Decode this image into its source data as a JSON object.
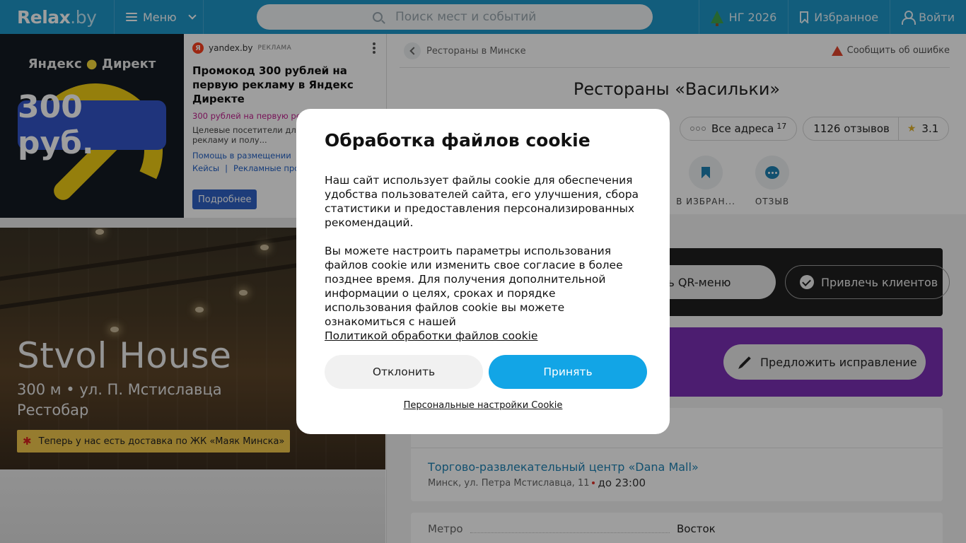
{
  "header": {
    "logo": "Relax",
    "logo_suffix": ".by",
    "menu_label": "Меню",
    "search_placeholder": "Поиск мест и событий",
    "ng_label": "НГ 2026",
    "favorites_label": "Избранное",
    "login_label": "Войти",
    "bg_color": "#1e96c8"
  },
  "ad": {
    "image_brand_left": "Яндекс",
    "image_brand_right": "Директ",
    "image_price": "300 руб.",
    "source": "yandex.by",
    "source_tag": "РЕКЛАМА",
    "title": "Промокод 300 рублей на первую рекламу в Яндекс Директе",
    "subtitle": "300 рублей на первую рекламу в подарок!",
    "text": "Целевые посетители для ли... Запустите рекламу и полу...",
    "links": [
      "Помощь в размещении",
      "|",
      "Кейсы",
      "|",
      "Рекламные про..."
    ],
    "button_label": "Подробнее"
  },
  "hero": {
    "title": "Stvol House",
    "address": "300 м • ул. П. Мстиславца",
    "type": "Рестобар",
    "banner": "Теперь у нас есть доставка по ЖК «Маяк Минска»"
  },
  "page": {
    "breadcrumb": "Рестораны в Минске",
    "report_label": "Сообщить об ошибке",
    "title": "Рестораны «Васильки»",
    "chips": {
      "addresses_label": "Все адреса",
      "addresses_count": "17",
      "reviews_label": "1126 отзывов",
      "rating": "3.1"
    },
    "actions": [
      {
        "label": "В ИЗБРАН..."
      },
      {
        "label": "ОТЗЫВ"
      }
    ],
    "qr_label": "ть QR-меню",
    "attract_label": "Привлечь клиентов",
    "suggest_label": "Предложить исправление",
    "mall_name": "Торгово-развлекательный центр «Dana Mall»",
    "mall_address": "Минск, ул. Петра Мстиславца, 11",
    "mall_hours": "до 23:00",
    "metro_key": "Метро",
    "metro_value": "Восток"
  },
  "cookie": {
    "title": "Обработка файлов cookie",
    "p1": "Наш сайт использует файлы cookie для обеспечения удобства пользователей сайта, его улучшения, сбора статистики и предоставления персонализированных рекомендаций.",
    "p2": "Вы можете настроить параметры использования файлов cookie или изменить свое согласие в более позднее время. Для получения дополнительной информации о целях, сроках и порядке использования файлов cookie вы можете ознакомиться с нашей",
    "policy_link": "Политикой обработки файлов cookie",
    "decline_label": "Отклонить",
    "accept_label": "Принять",
    "personal_label": "Персональные настройки Cookie",
    "accept_color": "#12a5e6"
  }
}
